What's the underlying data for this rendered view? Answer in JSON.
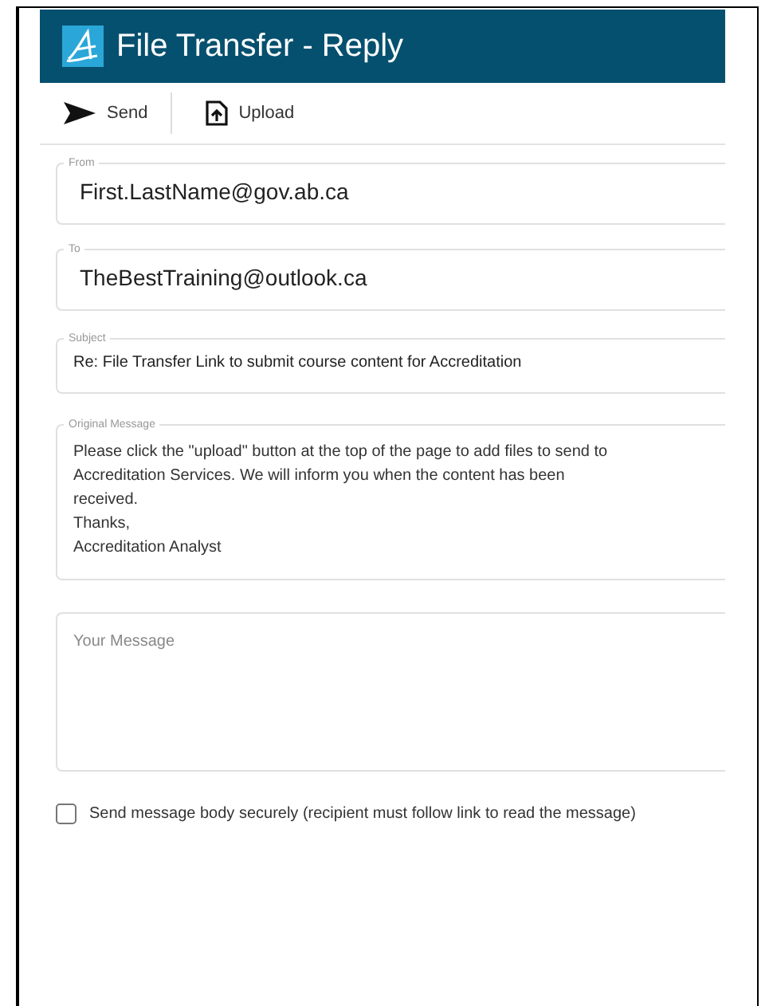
{
  "window": {
    "title": "File Transfer - Reply"
  },
  "toolbar": [
    {
      "label": "Send",
      "kind": "send"
    },
    {
      "label": "Upload",
      "kind": "upload"
    }
  ],
  "fields": [
    {
      "label": "From",
      "value": "First.LastName@gov.ab.ca",
      "kind": "large"
    },
    {
      "label": "To",
      "value": "TheBestTraining@outlook.ca",
      "kind": "large"
    },
    {
      "label": "Subject",
      "value": "Re: File Transfer Link to submit course content for Accreditation",
      "kind": "small"
    },
    {
      "label": "Original Message",
      "lines": [
        "Please click the \"upload\" button at the top of the page to add files to send to Accreditation Services. We will inform you when the content has been received.",
        "Thanks,",
        "Accreditation Analyst"
      ],
      "kind": "message"
    }
  ],
  "your_message": {
    "placeholder": "Your Message"
  },
  "secure_option": {
    "label": "Send message body securely (recipient must follow link to read the message)",
    "checked": false
  }
}
